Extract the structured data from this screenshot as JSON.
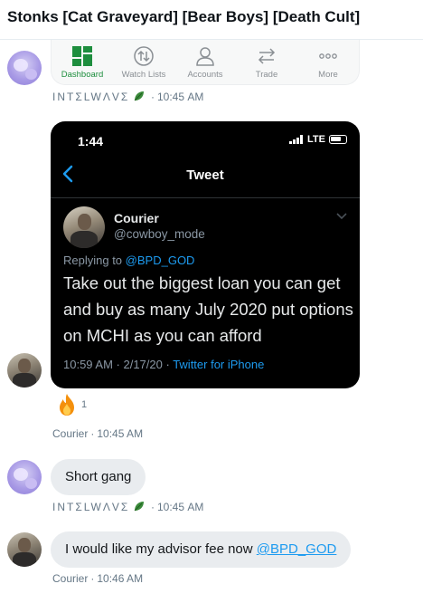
{
  "header": {
    "title": "Stonks [Cat Graveyard] [Bear Boys] [Death Cult]"
  },
  "app_nav": {
    "items": [
      {
        "label": "Dashboard",
        "icon": "dashboard-icon",
        "active": true
      },
      {
        "label": "Watch Lists",
        "icon": "watchlist-icon",
        "active": false
      },
      {
        "label": "Accounts",
        "icon": "accounts-icon",
        "active": false
      },
      {
        "label": "Trade",
        "icon": "trade-icon",
        "active": false
      },
      {
        "label": "More",
        "icon": "more-icon",
        "active": false
      }
    ]
  },
  "messages": [
    {
      "sender": "INTΣLWΛVΣ",
      "time": "10:45 AM"
    },
    {
      "sender": "Courier",
      "time": "10:45 AM",
      "screenshot": {
        "status_time": "1:44",
        "network": "LTE",
        "nav_title": "Tweet",
        "author_name": "Courier",
        "author_handle": "@cowboy_mode",
        "reply_prefix": "Replying to",
        "reply_to": "@BPD_GOD",
        "text": "Take out the biggest loan you can get and buy as many July 2020 put options on MCHI as you can afford",
        "timestamp": "10:59 AM · 2/17/20 ·",
        "source": "Twitter for iPhone"
      },
      "reaction": {
        "emoji": "fire-icon",
        "count": "1"
      }
    },
    {
      "sender": "INTΣLWΛVΣ",
      "time": "10:45 AM",
      "text": "Short gang"
    },
    {
      "sender": "Courier",
      "time": "10:46 AM",
      "text": "I would like my advisor fee now",
      "mention": "@BPD_GOD"
    }
  ],
  "colors": {
    "accent": "#1d9bf0",
    "bubble": "#e9ecef",
    "active_nav": "#1e8e3e"
  }
}
